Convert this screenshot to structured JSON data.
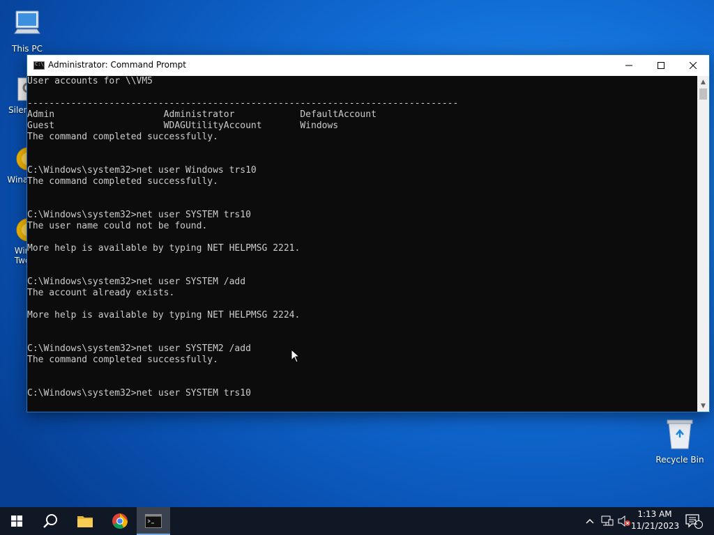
{
  "desktop": {
    "icons": [
      {
        "label": "This PC"
      },
      {
        "label": "Silent"
      },
      {
        "label": "Winae"
      },
      {
        "label": "Win Twe"
      },
      {
        "label": "Recycle Bin"
      }
    ]
  },
  "window": {
    "title": "Administrator: Command Prompt",
    "console_lines": [
      "User accounts for \\\\VM5",
      "",
      "-------------------------------------------------------------------------------",
      "Admin                    Administrator            DefaultAccount",
      "Guest                    WDAGUtilityAccount       Windows",
      "The command completed successfully.",
      "",
      "",
      "C:\\Windows\\system32>net user Windows trs10",
      "The command completed successfully.",
      "",
      "",
      "C:\\Windows\\system32>net user SYSTEM trs10",
      "The user name could not be found.",
      "",
      "More help is available by typing NET HELPMSG 2221.",
      "",
      "",
      "C:\\Windows\\system32>net user SYSTEM /add",
      "The account already exists.",
      "",
      "More help is available by typing NET HELPMSG 2224.",
      "",
      "",
      "C:\\Windows\\system32>net user SYSTEM2 /add",
      "The command completed successfully.",
      "",
      "",
      "C:\\Windows\\system32>net user SYSTEM trs10"
    ]
  },
  "taskbar": {
    "clock_time": "1:13 AM",
    "clock_date": "11/21/2023",
    "notification_count": "1"
  },
  "colors": {
    "console_bg": "#0c0c0c",
    "console_fg": "#cccccc",
    "taskbar_bg": "#101826"
  }
}
